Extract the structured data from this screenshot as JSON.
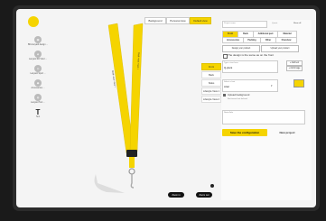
{
  "header": {
    "tabs": [
      "Background",
      "Personal view",
      "Default view"
    ],
    "active_tab": 2
  },
  "rail": {
    "items": [
      {
        "label": "BIG lanyard design ...",
        "icon": "lanyard-icon"
      },
      {
        "label": "Lanyard 3D Vivid ...",
        "icon": "cube-icon"
      },
      {
        "label": "Lanyard Sport ...",
        "icon": "ribbon-icon"
      },
      {
        "label": "Accessories ...",
        "icon": "clip-icon"
      },
      {
        "label": "Lanyard Text ...",
        "icon": "text-icon"
      },
      {
        "label": "Text",
        "icon": "T-icon"
      }
    ]
  },
  "views": [
    "Front",
    "Back",
    "Sides",
    "Lifestyle View 1",
    "Lifestyle View 2"
  ],
  "active_view": 0,
  "viewer": {
    "lanyard_text": "Draft • text • text •",
    "zoom_in": "Zoom in",
    "zoom_out": "Zoom out"
  },
  "panel": {
    "project_name_label": "Project name",
    "project_name_value": "",
    "qty_label": "Quant.",
    "qty_value": "Show all",
    "tabs": [
      "Front",
      "Back",
      "Additional part",
      "Material",
      "Accessories",
      "Packing",
      "Other",
      "Overview"
    ],
    "active_tab": 0,
    "sub_tabs": [
      "Design your product",
      "Upload your product"
    ],
    "same_front_label": "The design is the same as on the front",
    "text_field_label": "Type a text here",
    "text_field_value": "Q-plant",
    "add_text": "+ Add text",
    "add_image": "+ Add image",
    "select_font_label": "Select a font",
    "select_font_value": "Arial",
    "color_label": "Yellow",
    "upload_bg": "Upload background",
    "bg_hint": "Backround not defined",
    "notes_label": "Notes/Info",
    "notes_value": "",
    "save_label": "Save the configuration",
    "new_project": "New project"
  },
  "colors": {
    "accent": "#f5d400",
    "lanyard": "#f5d400"
  }
}
